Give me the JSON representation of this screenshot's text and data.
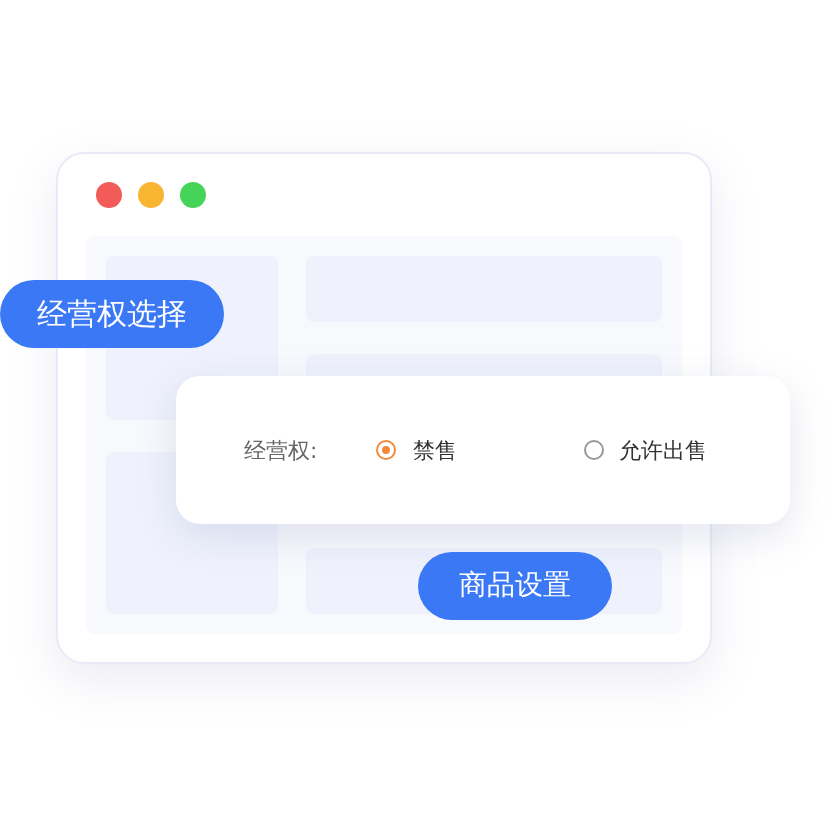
{
  "badge": {
    "label": "经营权选择"
  },
  "form": {
    "label": "经营权:",
    "options": [
      {
        "label": "禁售",
        "selected": true
      },
      {
        "label": "允许出售",
        "selected": false
      }
    ]
  },
  "button": {
    "label": "商品设置"
  }
}
